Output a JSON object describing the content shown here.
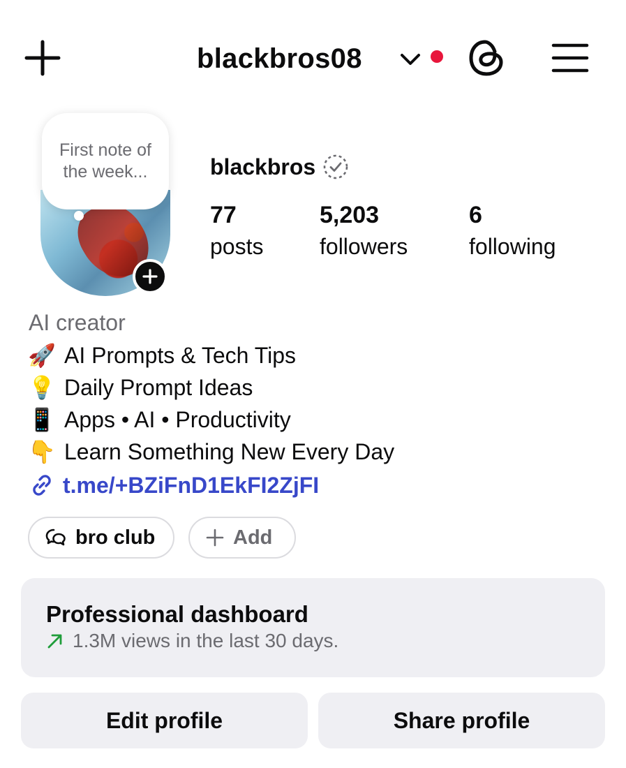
{
  "header": {
    "username": "blackbros08",
    "icons": [
      "plus-icon",
      "chevron-down-icon",
      "threads-icon",
      "menu-icon"
    ],
    "notification_color": "#e8163c"
  },
  "profile": {
    "note": "First note of the week...",
    "display_name": "blackbros",
    "stats": [
      {
        "value": "77",
        "label": "posts"
      },
      {
        "value": "5,203",
        "label": "followers"
      },
      {
        "value": "6",
        "label": "following"
      }
    ],
    "category": "AI creator",
    "bio": [
      {
        "emoji": "🚀",
        "text": "AI Prompts & Tech Tips"
      },
      {
        "emoji": "💡",
        "text": "Daily Prompt Ideas"
      },
      {
        "emoji": "📱",
        "text": "Apps • AI • Productivity"
      },
      {
        "emoji": "👇",
        "text": "Learn Something New Every Day"
      }
    ],
    "link": "t.me/+BZiFnD1EkFI2ZjFI",
    "link_color": "#3848c9"
  },
  "chips": {
    "channel": "bro club",
    "add": "Add"
  },
  "dashboard": {
    "title": "Professional dashboard",
    "subtitle": "1.3M views in the last 30 days.",
    "trend_color": "#1f9d3a"
  },
  "actions": {
    "edit": "Edit profile",
    "share": "Share profile"
  }
}
